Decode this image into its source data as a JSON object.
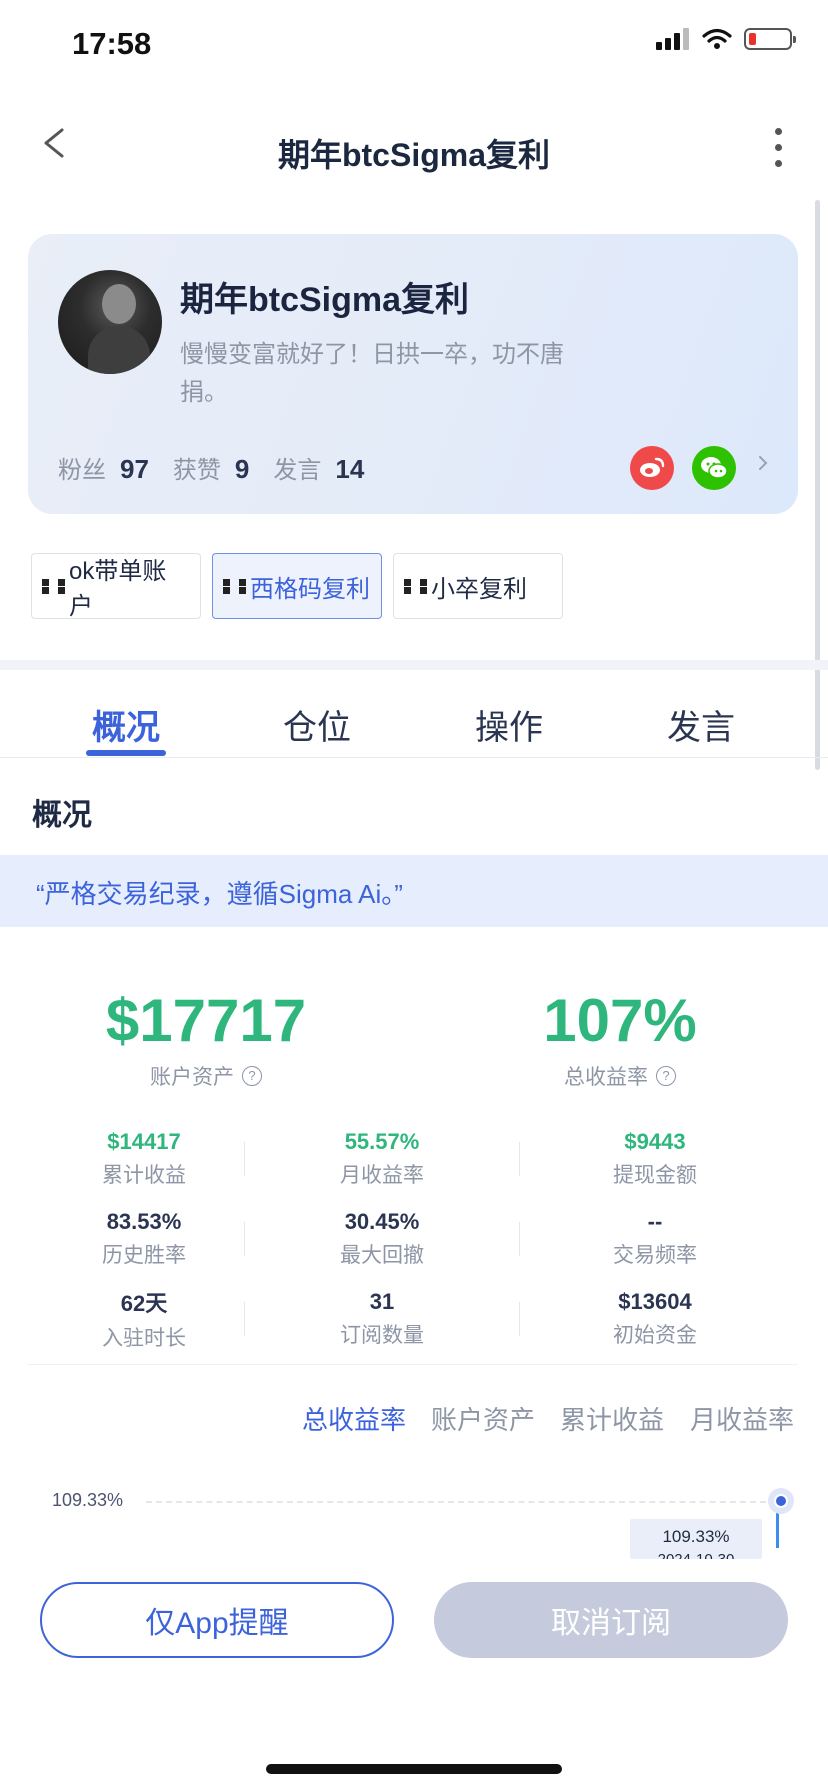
{
  "status_bar": {
    "time": "17:58"
  },
  "nav": {
    "title": "期年btcSigma复利"
  },
  "profile": {
    "name": "期年btcSigma复利",
    "bio": "慢慢变富就好了！日拱一卒，功不唐捐。",
    "stats": [
      {
        "label": "粉丝",
        "value": "97"
      },
      {
        "label": "获赞",
        "value": "9"
      },
      {
        "label": "发言",
        "value": "14"
      }
    ]
  },
  "accounts": [
    {
      "label": "ok带单账户",
      "active": false
    },
    {
      "label": "西格码复利",
      "active": true
    },
    {
      "label": "小卒复利",
      "active": false
    }
  ],
  "tabs": [
    "概况",
    "仓位",
    "操作",
    "发言"
  ],
  "section_title": "概况",
  "quote": "“严格交易纪录，遵循Sigma Ai。”",
  "summary": {
    "account_assets": {
      "value": "$17717",
      "label": "账户资产"
    },
    "total_return": {
      "value": "107%",
      "label": "总收益率"
    }
  },
  "grid": [
    [
      {
        "value": "$14417",
        "label": "累计收益",
        "green": true
      },
      {
        "value": "55.57%",
        "label": "月收益率",
        "green": true
      },
      {
        "value": "$9443",
        "label": "提现金额",
        "green": true
      }
    ],
    [
      {
        "value": "83.53%",
        "label": "历史胜率"
      },
      {
        "value": "30.45%",
        "label": "最大回撤"
      },
      {
        "value": "--",
        "label": "交易频率"
      }
    ],
    [
      {
        "value": "62天",
        "label": "入驻时长"
      },
      {
        "value": "31",
        "label": "订阅数量"
      },
      {
        "value": "$13604",
        "label": "初始资金"
      }
    ]
  ],
  "chart_tabs": [
    "总收益率",
    "账户资产",
    "累计收益",
    "月收益率"
  ],
  "chart": {
    "y_label": "109.33%",
    "tooltip_value": "109.33%",
    "tooltip_date": "2024-10-30"
  },
  "buttons": {
    "remind": "仅App提醒",
    "unsubscribe": "取消订阅"
  },
  "colors": {
    "accent": "#3d63db",
    "positive": "#2eb67d"
  }
}
